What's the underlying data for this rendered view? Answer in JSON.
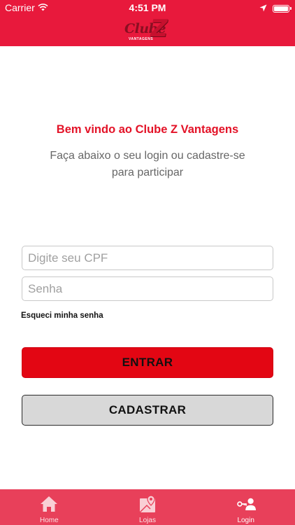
{
  "status_bar": {
    "carrier": "Carrier",
    "time": "4:51 PM"
  },
  "header": {
    "logo_main": "Clube",
    "logo_letter": "Z",
    "logo_sub": "VANTAGENS"
  },
  "welcome": {
    "title": "Bem vindo ao Clube Z Vantagens",
    "subtitle": "Faça abaixo o seu login ou cadastre-se para participar"
  },
  "form": {
    "cpf_placeholder": "Digite seu CPF",
    "cpf_value": "",
    "password_placeholder": "Senha",
    "password_value": "",
    "forgot_label": "Esqueci minha senha",
    "enter_label": "ENTRAR",
    "register_label": "CADASTRAR"
  },
  "tabbar": {
    "items": [
      {
        "label": "Home",
        "icon": "home-icon",
        "active": false
      },
      {
        "label": "Lojas",
        "icon": "map-icon",
        "active": false
      },
      {
        "label": "Login",
        "icon": "user-key-icon",
        "active": true
      }
    ]
  },
  "colors": {
    "brand_red": "#e8193c",
    "button_red": "#e30613",
    "tabbar": "#e8405a",
    "title_red": "#e31227"
  }
}
